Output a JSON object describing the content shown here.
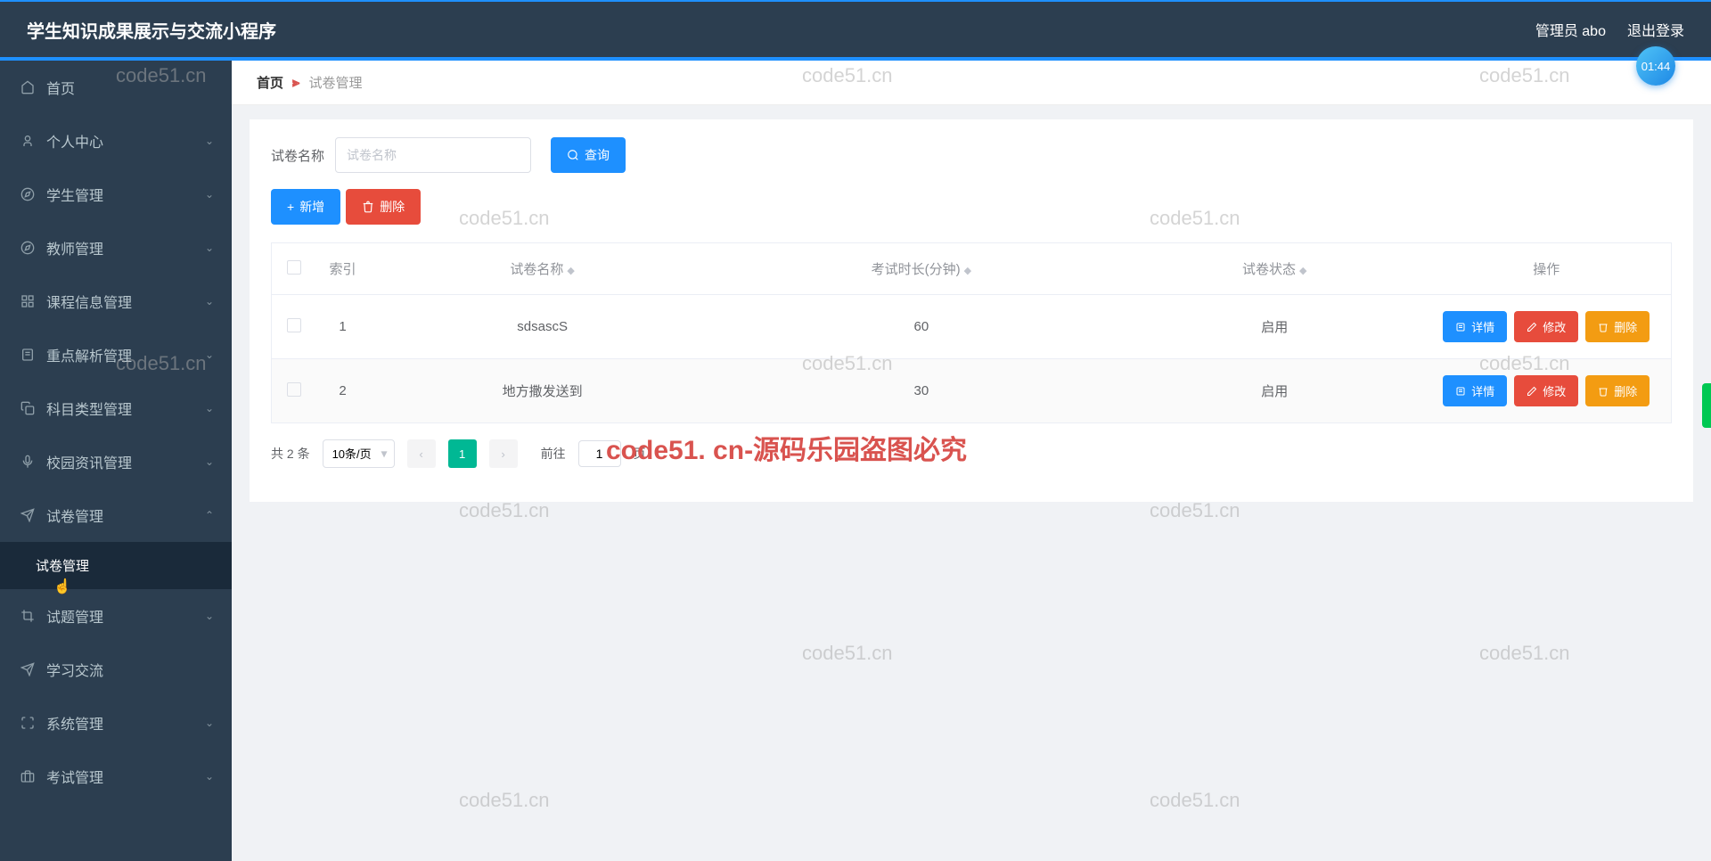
{
  "header": {
    "title": "学生知识成果展示与交流小程序",
    "user_label": "管理员 abo",
    "logout_label": "退出登录",
    "timer": "01:44"
  },
  "sidebar": {
    "items": [
      {
        "icon": "home",
        "label": "首页",
        "chevron": false
      },
      {
        "icon": "user",
        "label": "个人中心",
        "chevron": true
      },
      {
        "icon": "compass",
        "label": "学生管理",
        "chevron": true
      },
      {
        "icon": "compass",
        "label": "教师管理",
        "chevron": true
      },
      {
        "icon": "grid",
        "label": "课程信息管理",
        "chevron": true
      },
      {
        "icon": "doc",
        "label": "重点解析管理",
        "chevron": true
      },
      {
        "icon": "copy",
        "label": "科目类型管理",
        "chevron": true
      },
      {
        "icon": "mic",
        "label": "校园资讯管理",
        "chevron": true
      },
      {
        "icon": "send",
        "label": "试卷管理",
        "chevron": true,
        "expanded": true
      },
      {
        "icon": "crop",
        "label": "试题管理",
        "chevron": true
      },
      {
        "icon": "send",
        "label": "学习交流",
        "chevron": false
      },
      {
        "icon": "expand",
        "label": "系统管理",
        "chevron": true
      },
      {
        "icon": "briefcase",
        "label": "考试管理",
        "chevron": true
      }
    ],
    "subitem_label": "试卷管理"
  },
  "breadcrumb": {
    "home": "首页",
    "current": "试卷管理"
  },
  "filter": {
    "label": "试卷名称",
    "placeholder": "试卷名称",
    "query_btn": "查询"
  },
  "actions": {
    "add": "新增",
    "delete": "删除"
  },
  "table": {
    "headers": {
      "index": "索引",
      "name": "试卷名称",
      "duration": "考试时长(分钟)",
      "status": "试卷状态",
      "ops": "操作"
    },
    "rows": [
      {
        "index": "1",
        "name": "sdsascS",
        "duration": "60",
        "status": "启用"
      },
      {
        "index": "2",
        "name": "地方撒发送到",
        "duration": "30",
        "status": "启用"
      }
    ],
    "row_actions": {
      "detail": "详情",
      "edit": "修改",
      "delete": "删除"
    }
  },
  "pagination": {
    "total_label": "共 2 条",
    "per_page": "10条/页",
    "current_page": "1",
    "goto_prefix": "前往",
    "goto_value": "1",
    "goto_suffix": "页"
  },
  "watermarks": {
    "text": "code51.cn",
    "center_text": "code51. cn-源码乐园盗图必究"
  }
}
